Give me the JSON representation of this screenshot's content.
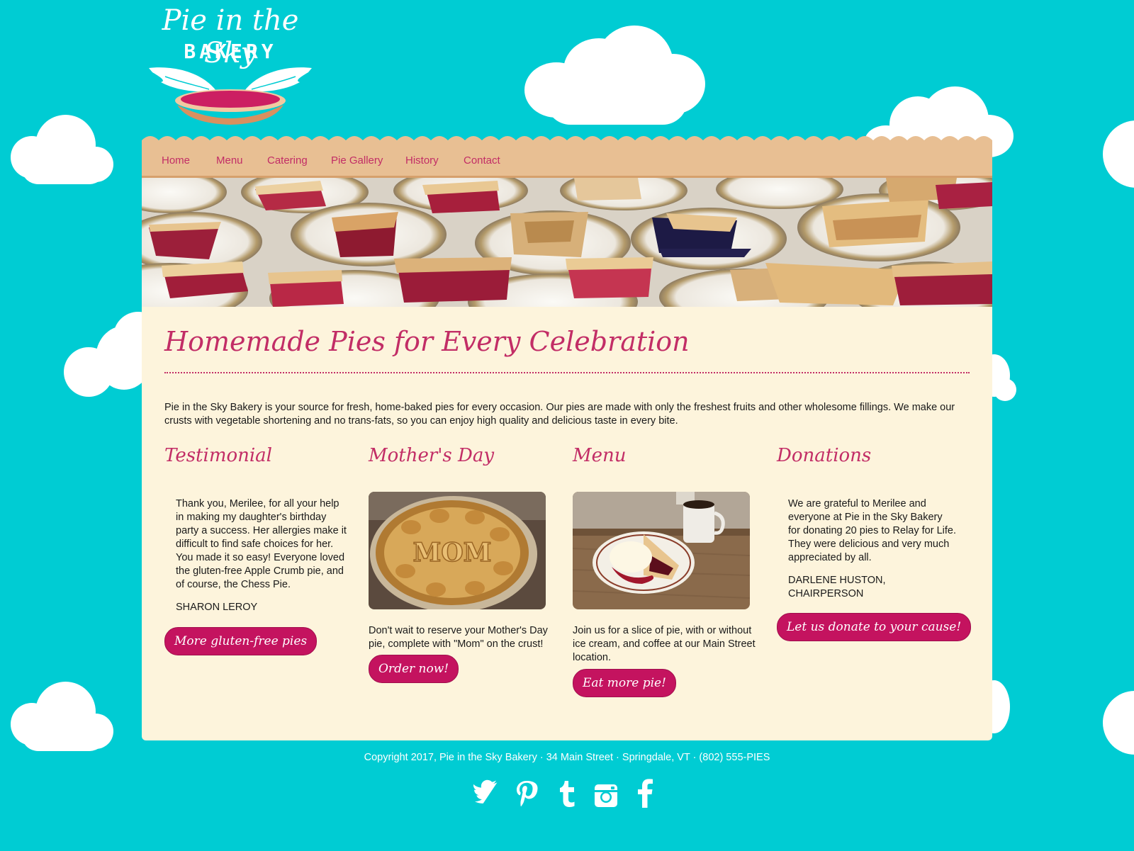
{
  "brand": {
    "logo_script": "Pie in the Sky",
    "logo_word": "BAKERY",
    "colors": {
      "sky": "#00ccd3",
      "accent": "#c22d66",
      "nav": "#e8bf93",
      "content": "#fdf4dc",
      "button": "#c4135f"
    }
  },
  "nav": {
    "items": [
      {
        "label": "Home"
      },
      {
        "label": "Menu"
      },
      {
        "label": "Catering"
      },
      {
        "label": "Pie Gallery"
      },
      {
        "label": "History"
      },
      {
        "label": "Contact"
      }
    ]
  },
  "main": {
    "title": "Homemade Pies for Every Celebration",
    "intro": "Pie in the Sky Bakery is your source for fresh, home-baked pies for every occasion. Our pies are made with only the freshest fruits and other wholesome fillings. We make our crusts with vegetable shortening and no trans-fats, so you can enjoy high quality and delicious taste in every bite."
  },
  "columns": {
    "testimonial": {
      "heading": "Testimonial",
      "quote": "Thank you, Merilee, for all your help in making my daughter's birthday party a success. Her allergies make it difficult to find safe choices for her. You made it so easy! Everyone loved the gluten-free Apple Crumb pie, and of course, the Chess Pie.",
      "author": "SHARON LEROY",
      "button": "More gluten-free pies"
    },
    "mothers_day": {
      "heading": "Mother's Day",
      "text": "Don't wait to reserve your Mother's Day pie, complete with \"Mom\" on the crust!",
      "pie_word": "MOM",
      "button": "Order now!"
    },
    "menu": {
      "heading": "Menu",
      "text": "Join us for a slice of pie, with or without ice cream, and coffee at our Main Street location.",
      "button": "Eat more pie!"
    },
    "donations": {
      "heading": "Donations",
      "text": "We are grateful to Merilee and everyone at Pie in the Sky Bakery for donating 20 pies to Relay for Life. They were delicious and very much appreciated by all.",
      "author": "DARLENE HUSTON, CHAIRPERSON",
      "button": "Let us donate to your cause!"
    }
  },
  "footer": {
    "copyright": "Copyright 2017, Pie in the Sky Bakery · 34 Main Street · Springdale, VT · (802) 555-PIES",
    "social": [
      "twitter-icon",
      "pinterest-icon",
      "tumblr-icon",
      "instagram-icon",
      "facebook-icon"
    ]
  }
}
